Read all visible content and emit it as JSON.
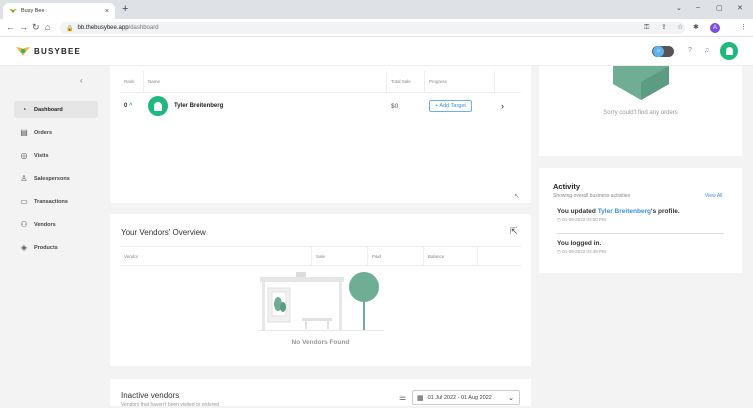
{
  "browser": {
    "tab_title": "Busy Bee",
    "tab_close": "×",
    "new_tab": "+",
    "url_host": "bb.thebusybee.app",
    "url_path": "/dashboard",
    "profile_initial": "A",
    "win_min": "–",
    "win_max": "▢",
    "win_close": "✕",
    "chevron": "⌄"
  },
  "app": {
    "brand": "BUSYBEE"
  },
  "sidebar": {
    "items": [
      {
        "label": "Dashboard",
        "icon": "dashboard-icon",
        "glyph": "◔",
        "active": true
      },
      {
        "label": "Orders",
        "icon": "orders-icon",
        "glyph": "▤"
      },
      {
        "label": "Visits",
        "icon": "visits-icon",
        "glyph": "◎"
      },
      {
        "label": "Salespersons",
        "icon": "salespersons-icon",
        "glyph": "♙"
      },
      {
        "label": "Transactions",
        "icon": "transactions-icon",
        "glyph": "▭"
      },
      {
        "label": "Vendors",
        "icon": "vendors-icon",
        "glyph": "⚇"
      },
      {
        "label": "Products",
        "icon": "products-icon",
        "glyph": "◈"
      }
    ]
  },
  "salespersons_table": {
    "headers": [
      "Rank",
      "Name",
      "Total Sale",
      "Progress"
    ],
    "rows": [
      {
        "rank": "0",
        "trend": "^",
        "name": "Tyler Breitenberg",
        "sale": "$0",
        "action": "+ Add Target"
      }
    ]
  },
  "orders_card": {
    "empty_text": "Sorry could't find any orders"
  },
  "activity": {
    "title": "Activity",
    "subtitle": "Showing overall business activities",
    "view_all": "View All",
    "items": [
      {
        "prefix": "You updated ",
        "name": "Tyler Breitenberg",
        "suffix": "'s profile.",
        "time": "01-08-2022 03:50 PM"
      },
      {
        "prefix": "You logged in.",
        "name": "",
        "suffix": "",
        "time": "01-08-2022 03:49 PM"
      }
    ]
  },
  "vendors": {
    "title": "Your Vendors' Overview",
    "headers": [
      "Vendor",
      "Sale",
      "Paid",
      "Balance"
    ],
    "empty_text": "No Vendors Found"
  },
  "inactive": {
    "title": "Inactive vendors",
    "subtitle": "Vendors that haven't been visited or ordered",
    "date_range": "01 Jul 2022 - 01 Aug 2022"
  },
  "colors": {
    "brand_green": "#1fb87f",
    "accent_blue": "#3d8fe0",
    "illustration_green": "#6fae95"
  }
}
